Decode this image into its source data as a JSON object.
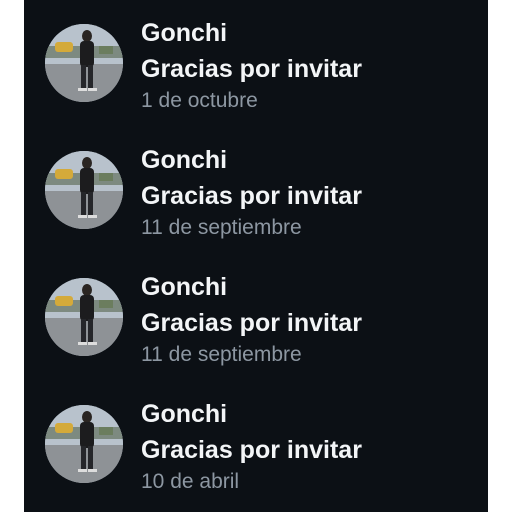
{
  "notifications": [
    {
      "name": "Gonchi",
      "message": "Gracias por invitar",
      "date": "1 de octubre",
      "avatar_icon": "profile-photo"
    },
    {
      "name": "Gonchi",
      "message": "Gracias por invitar",
      "date": "11 de septiembre",
      "avatar_icon": "profile-photo"
    },
    {
      "name": "Gonchi",
      "message": "Gracias por invitar",
      "date": "11 de septiembre",
      "avatar_icon": "profile-photo"
    },
    {
      "name": "Gonchi",
      "message": "Gracias por invitar",
      "date": "10 de abril",
      "avatar_icon": "profile-photo"
    }
  ],
  "colors": {
    "background": "#0c1015",
    "primary_text": "#f3f5f7",
    "secondary_text": "#8d97a2"
  }
}
